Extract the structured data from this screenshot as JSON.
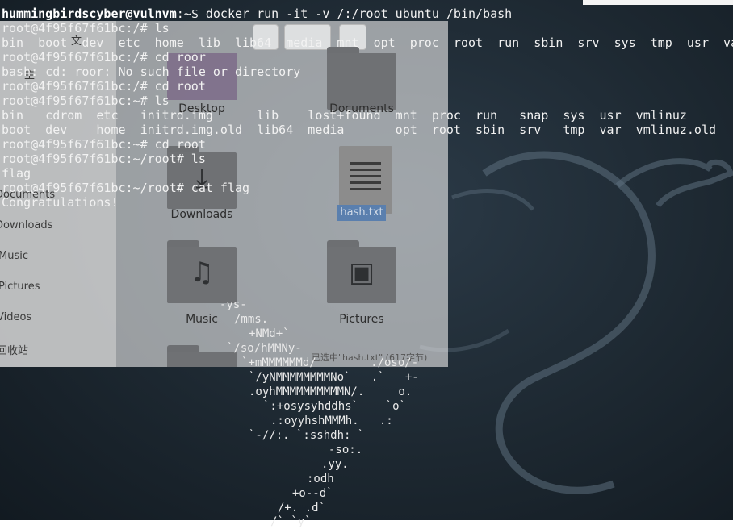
{
  "terminal": {
    "prompt_host": "hummingbirdscyber@vulnvm",
    "prompt_suffix": ":~$ docker run -it -v /:/root ubuntu /bin/bash",
    "lines": [
      "root@4f95f67f61bc:/# ls",
      "bin  boot  dev  etc  home  lib  lib64  media  mnt  opt  proc  root  run  sbin  srv  sys  tmp  usr  var",
      "root@4f95f67f61bc:/# cd roor",
      "bash: cd: roor: No such file or directory",
      "root@4f95f67f61bc:/# cd root",
      "root@4f95f67f61bc:~# ls",
      "bin   cdrom  etc   initrd.img      lib    lost+found  mnt  proc  run   snap  sys  usr  vmlinuz",
      "boot  dev    home  initrd.img.old  lib64  media       opt  root  sbin  srv   tmp  var  vmlinuz.old",
      "root@4f95f67f61bc:~# cd root",
      "root@4f95f67f61bc:~/root# ls",
      "flag",
      "root@4f95f67f61bc:~/root# cat flag",
      "Congratulations!"
    ],
    "ascii_art": [
      "-ys-",
      "/mms.",
      "+NMd+`",
      "`/so/hMMNy-",
      "`+mMMMMMMd/        ./oso/-",
      "`/yNMMMMMMMMNo`   .`   +-",
      ".oyhMMMMMMMMMMN/.     o.",
      "`:+osysyhddhs`    `o`",
      ".:oyyhshMMMh.   .:",
      "`-//:. `:sshdh: `",
      "-so:.",
      ".yy.",
      ":odh",
      "+o--d`",
      "/+. .d`",
      "/` `y`"
    ]
  },
  "file_manager": {
    "sidebar": [
      "Documents",
      "Downloads",
      "Music",
      "Pictures",
      "Videos",
      "回收站"
    ],
    "toolbar_partial": "文",
    "sidebar_partial_top": "主",
    "items": [
      "Desktop",
      "Documents",
      "Downloads",
      "hash.txt",
      "Music",
      "Pictures"
    ],
    "status": "已选中\"hash.txt\" (617字节)"
  },
  "colors": {
    "terminal_text": "#f2f2f2",
    "wallpaper": "#1d2831",
    "selection": "#5a7fae"
  }
}
